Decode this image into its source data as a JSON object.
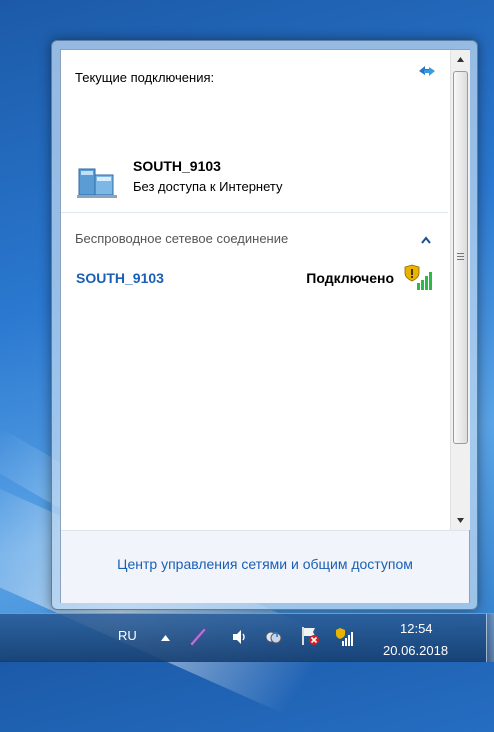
{
  "flyout": {
    "current_title": "Текущие подключения:",
    "network": {
      "name": "SOUTH_9103",
      "status": "Без доступа к Интернету"
    },
    "section_title": "Беспроводное сетевое соединение",
    "wifi": {
      "name": "SOUTH_9103",
      "status": "Подключено"
    },
    "footer_link": "Центр управления сетями и общим доступом"
  },
  "taskbar": {
    "language": "RU",
    "time": "12:54",
    "date": "20.06.2018"
  },
  "icons": {
    "refresh": "refresh-icon",
    "network": "network-computer-icon",
    "collapse": "chevron-up-icon",
    "signal": "wifi-signal-shield-icon",
    "pen": "pen-icon",
    "speaker": "speaker-icon",
    "sync": "sync-icon",
    "flag": "action-center-flag-icon",
    "tray_signal": "tray-signal-icon"
  },
  "colors": {
    "link": "#1a5fb4",
    "signal": "#2fb84a",
    "warning": "#e8b400"
  }
}
